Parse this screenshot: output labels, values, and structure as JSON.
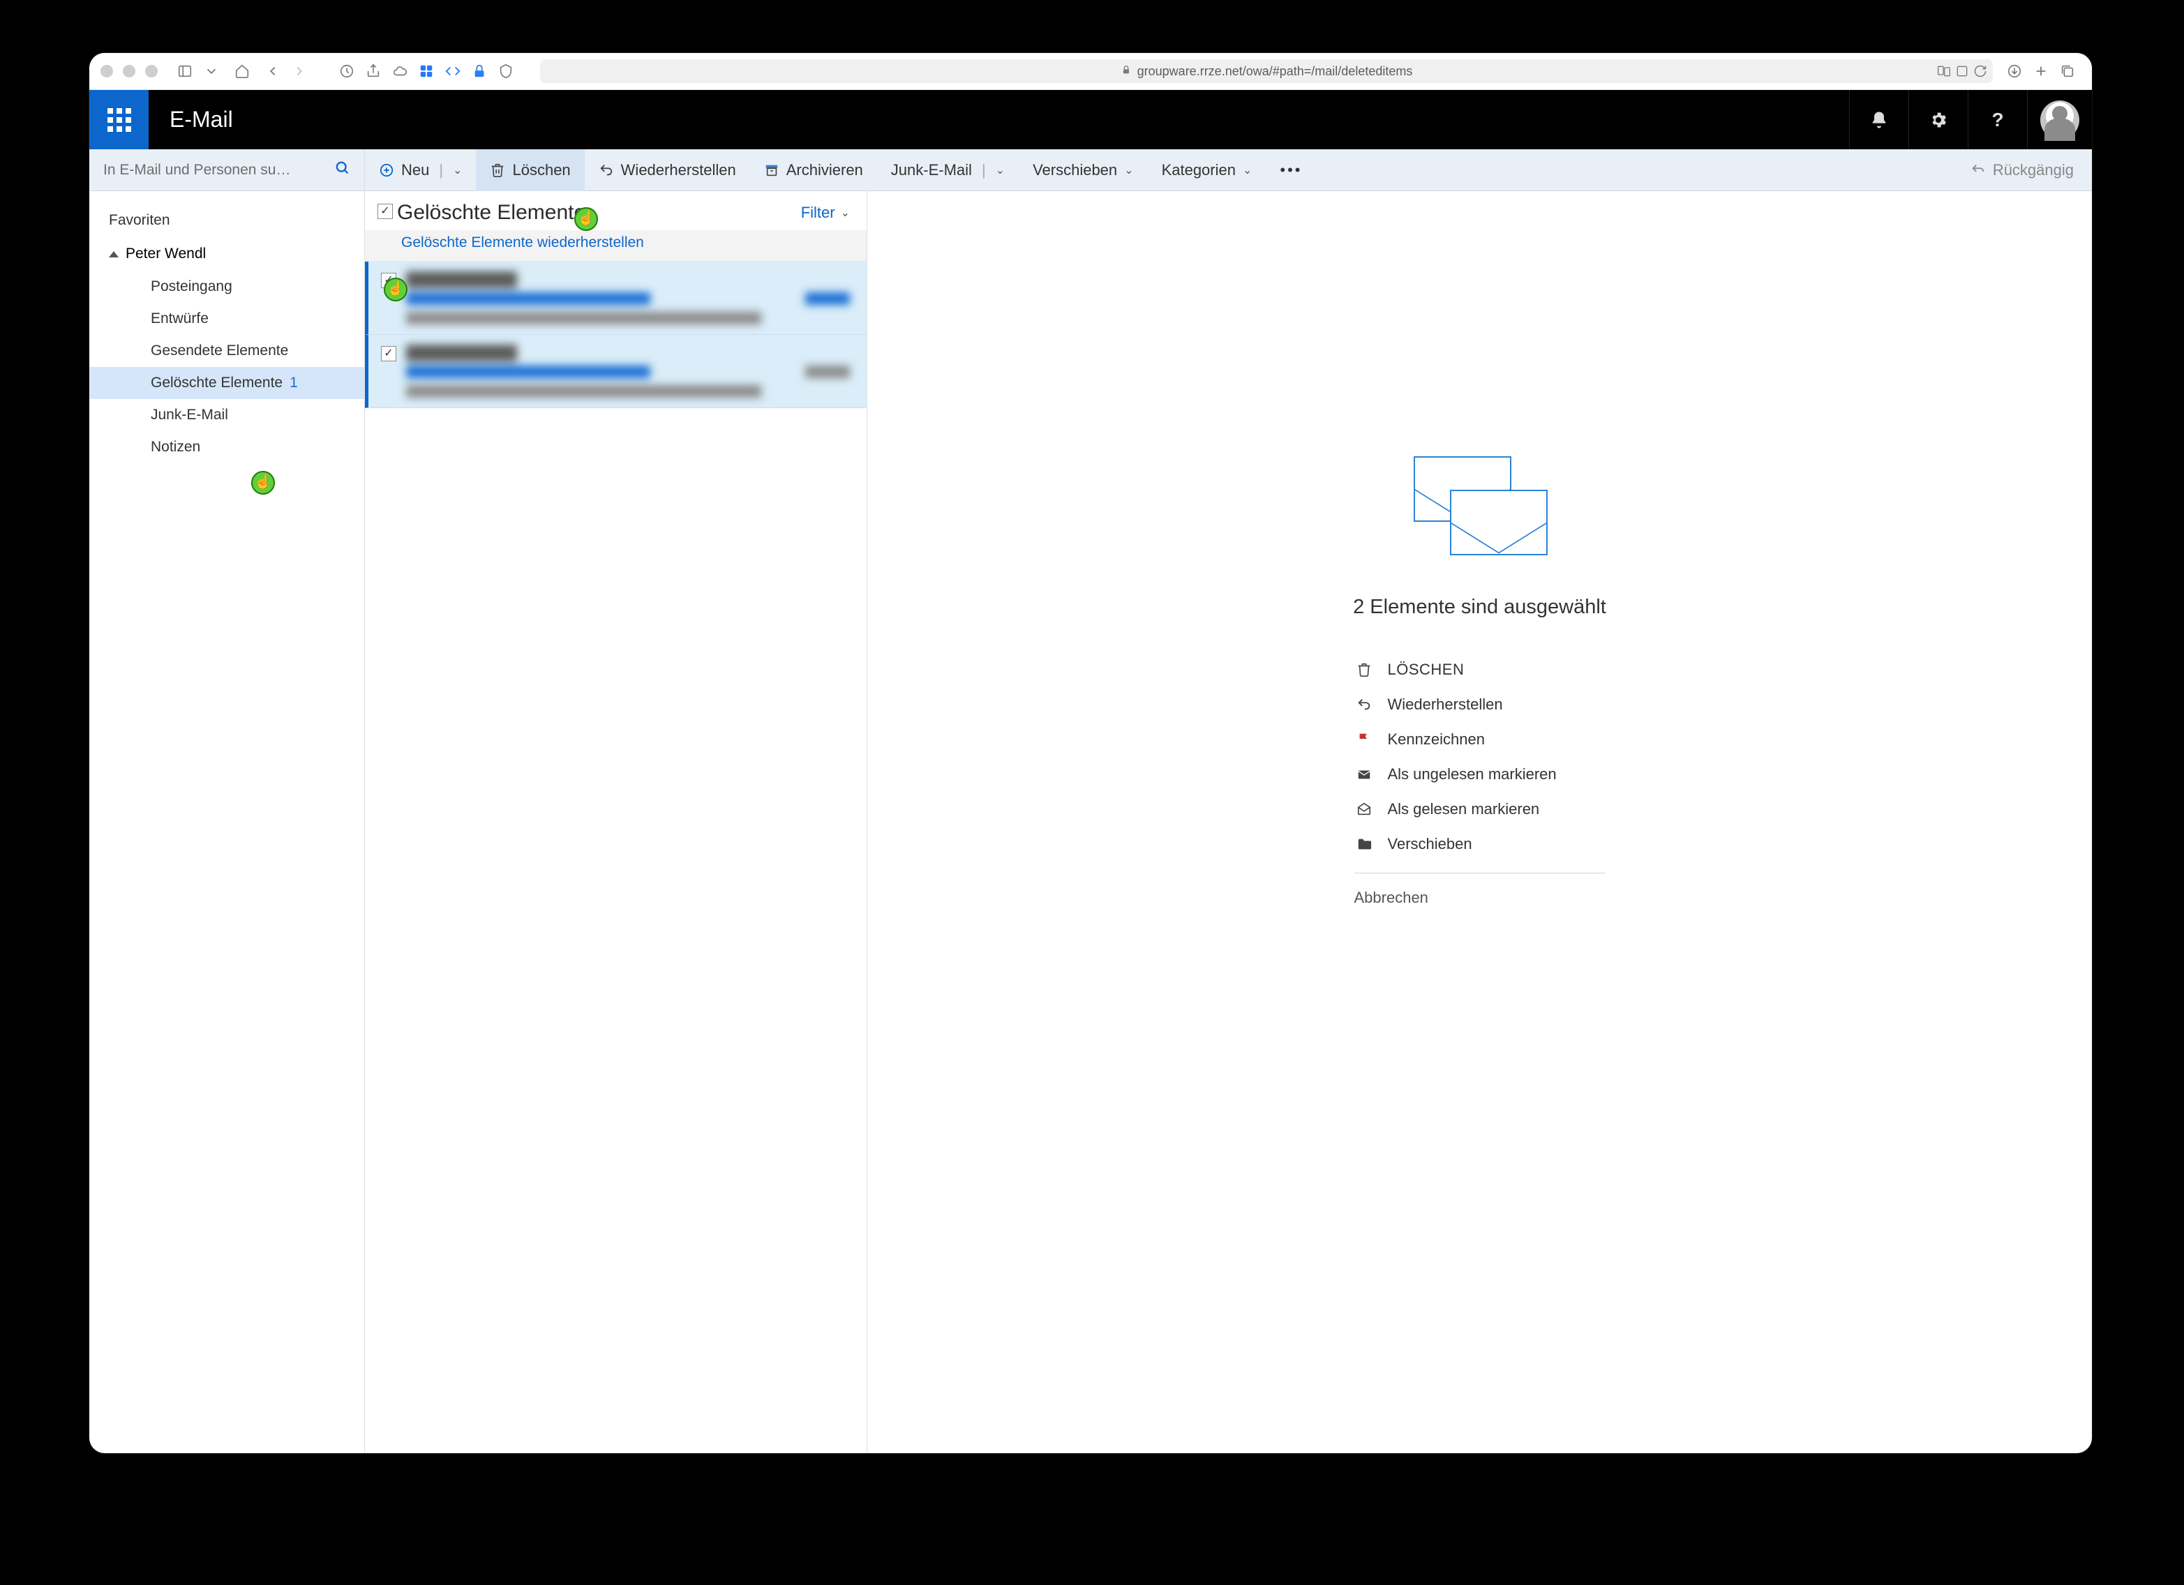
{
  "browser": {
    "url": "groupware.rrze.net/owa/#path=/mail/deleteditems"
  },
  "app": {
    "title": "E-Mail"
  },
  "search": {
    "placeholder": "In E-Mail und Personen su…"
  },
  "toolbar": {
    "new": "Neu",
    "delete": "Löschen",
    "restore": "Wiederherstellen",
    "archive": "Archivieren",
    "junk": "Junk-E-Mail",
    "move": "Verschieben",
    "categories": "Kategorien",
    "undo": "Rückgängig"
  },
  "folders": {
    "favorites": "Favoriten",
    "account": "Peter Wendl",
    "items": [
      {
        "label": "Posteingang"
      },
      {
        "label": "Entwürfe"
      },
      {
        "label": "Gesendete Elemente"
      },
      {
        "label": "Gelöschte Elemente",
        "count": "1",
        "selected": true
      },
      {
        "label": "Junk-E-Mail"
      },
      {
        "label": "Notizen"
      }
    ]
  },
  "messageList": {
    "title": "Gelöschte Elemente",
    "filter": "Filter",
    "restoreDeleted": "Gelöschte Elemente wiederherstellen"
  },
  "readingPane": {
    "selectionText": "2 Elemente sind ausgewählt",
    "actions": {
      "delete": "LÖSCHEN",
      "restore": "Wiederherstellen",
      "flag": "Kennzeichnen",
      "markUnread": "Als ungelesen markieren",
      "markRead": "Als gelesen markieren",
      "move": "Verschieben",
      "cancel": "Abbrechen"
    }
  }
}
